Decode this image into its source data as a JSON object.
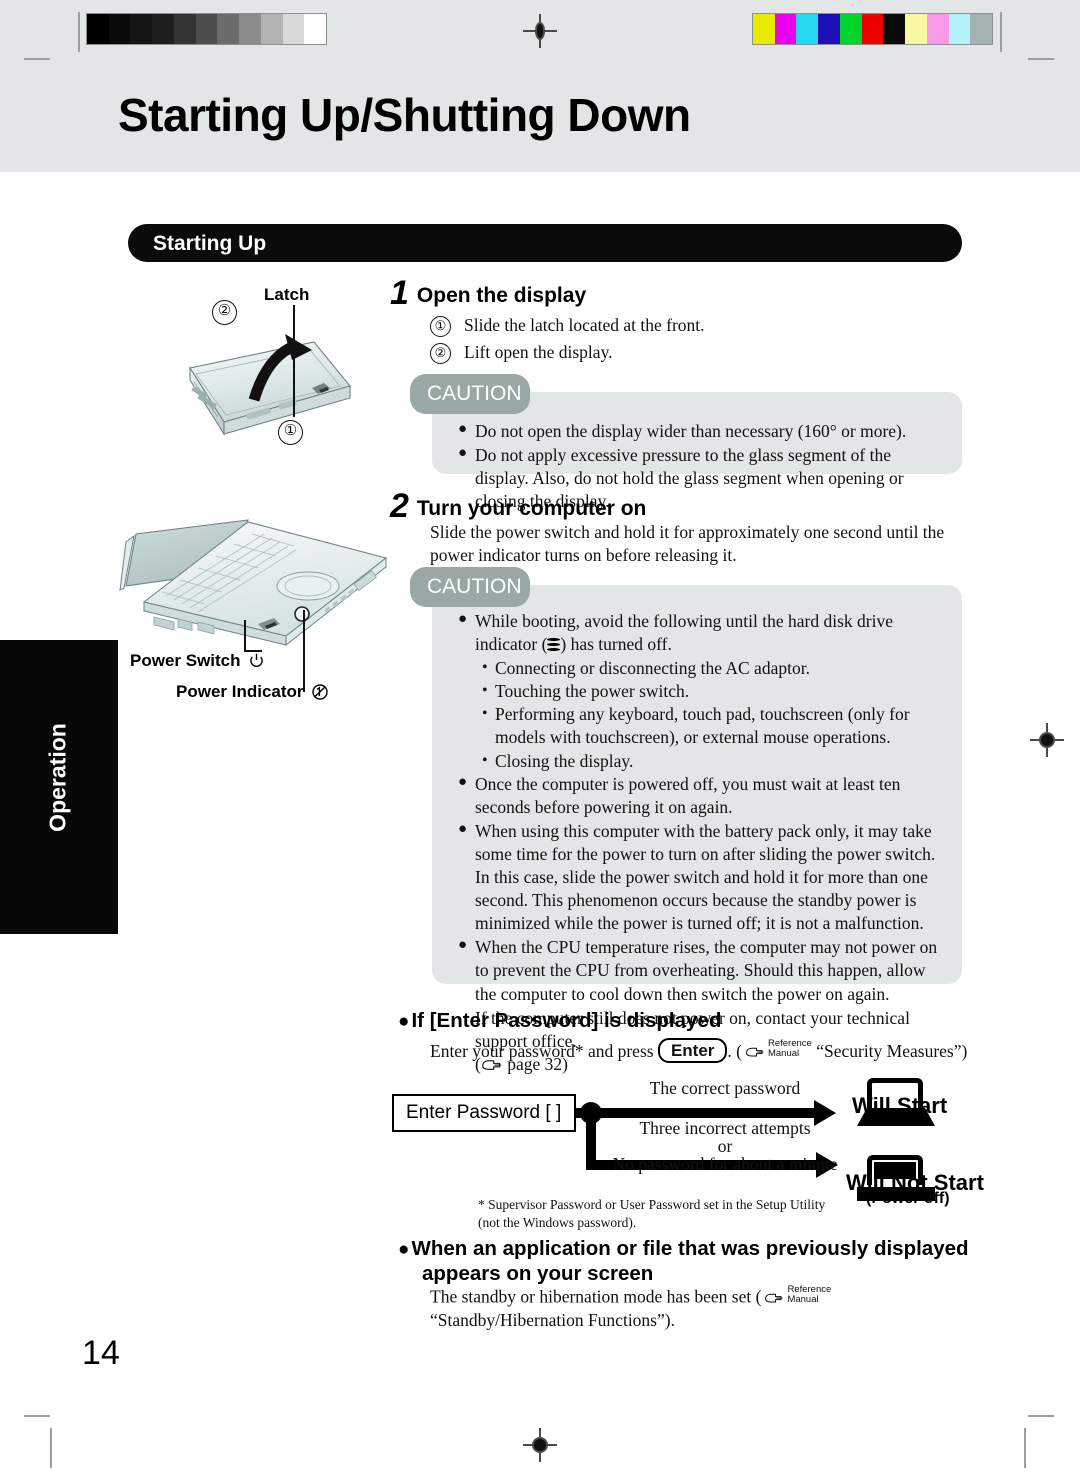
{
  "header": {
    "title": "Starting Up/Shutting Down",
    "band_color": "#e2e6e6"
  },
  "calibration": {
    "grayscale_steps": [
      "#000000",
      "#0a0a0a",
      "#141414",
      "#1e1e1e",
      "#333333",
      "#4d4d4d",
      "#6b6b6b",
      "#8c8c8c",
      "#b3b3b3",
      "#d9d9d9",
      "#ffffff"
    ],
    "color_steps": [
      "#eaea00",
      "#ec00ec",
      "#26d7f2",
      "#1c0fb5",
      "#00d52b",
      "#ee0000",
      "#0a0a0a",
      "#f7f7a0",
      "#f99ae8",
      "#b4f2fb",
      "#a3b2b2"
    ]
  },
  "sidebar": {
    "tab_label": "Operation"
  },
  "section": {
    "pill_label": "Starting Up"
  },
  "steps": [
    {
      "number": "1",
      "title": "Open the display",
      "items": [
        {
          "marker": "①",
          "text": "Slide the latch located at the front."
        },
        {
          "marker": "②",
          "text": "Lift open the display."
        }
      ],
      "caution": {
        "tag": "CAUTION",
        "bullets": [
          "Do not open the display wider than necessary (160° or more).",
          "Do not apply excessive pressure to the glass segment of the display.  Also, do not hold the glass segment when opening or closing the display."
        ]
      }
    },
    {
      "number": "2",
      "title": "Turn your computer on",
      "intro": "Slide the power switch and hold it for approximately one second until the power indicator turns on before releasing it.",
      "caution": {
        "tag": "CAUTION",
        "bullet1_a": "While booting, avoid the following until the hard disk drive indicator (",
        "bullet1_b": ") has turned off.",
        "subbullets": [
          "Connecting or disconnecting the AC adaptor.",
          "Touching the power switch.",
          "Performing any keyboard, touch pad, touchscreen (only for models with touchscreen), or external mouse operations.",
          "Closing the display."
        ],
        "bullet2": "Once the computer is powered off, you must wait at least ten seconds before powering it on again.",
        "bullet3": "When using this computer with the battery pack only, it may take some time for the power to turn on after sliding the power switch.  In this case, slide the power switch and hold it for more than one second.  This phenomenon occurs because the standby power is minimized while the power is turned off; it is not a malfunction.",
        "bullet4": "When the CPU temperature rises, the computer may not power on to prevent the CPU from overheating.  Should this happen, allow the computer to cool down then switch the power on again.",
        "bullet4_extra": "If the computer still does not power on, contact your technical support office.",
        "bullet4_ref": "page 32"
      }
    }
  ],
  "illustrations": {
    "latch_label": "Latch",
    "latch_mark_1": "①",
    "latch_mark_2": "②",
    "power_switch_label": "Power Switch",
    "power_indicator_label": "Power Indicator"
  },
  "password_section": {
    "heading": "If [Enter Password] is displayed",
    "intro_before": "Enter your password* and press",
    "key_label": "Enter",
    "intro_after_paren": ". (",
    "ref_line1": "Reference",
    "ref_line2": "Manual",
    "ref_title": "“Security Measures”)",
    "flow": {
      "box_label": "Enter Password [          ]",
      "branch_top": "The correct password",
      "branch_bottom_1": "Three incorrect attempts",
      "branch_bottom_or": "or",
      "branch_bottom_2": "No password for about a minute",
      "result_top": "Will Start",
      "result_bottom": "Will Not Start",
      "result_bottom_sub": "(Power off)"
    },
    "footnote": "* Supervisor Password or User Password set in the Setup Utility (not the Windows password)."
  },
  "app_section": {
    "heading_line1": "When an application or file that was previously displayed",
    "heading_line2": "appears on your screen",
    "body_before": "The standby or hibernation mode has been set (",
    "ref_line1": "Reference",
    "ref_line2": "Manual",
    "body_after": "“Standby/Hibernation Functions”)."
  },
  "footer": {
    "page_number": "14"
  }
}
